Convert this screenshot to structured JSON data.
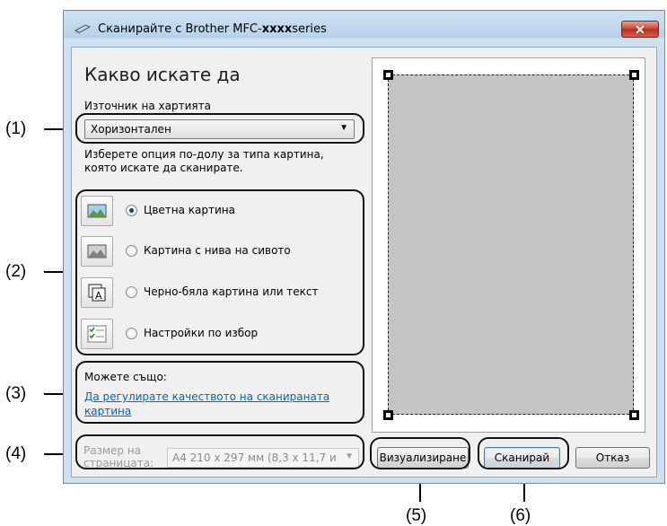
{
  "window": {
    "title_prefix": "Сканирайте с Brother MFC-",
    "title_bold": "xxxx",
    "title_suffix": "series",
    "close_label": "✕"
  },
  "heading": "Какво искате да",
  "paper_source": {
    "label": "Източник на хартията",
    "value": "Хоризонтален"
  },
  "instruction": {
    "line1": "Изберете опция по-долу за типа картина,",
    "line2": "която искате да сканирате."
  },
  "options": [
    {
      "label": "Цветна картина",
      "selected": true,
      "icon": "color-picture-icon"
    },
    {
      "label": "Картина с нива на сивото",
      "selected": false,
      "icon": "grayscale-picture-icon"
    },
    {
      "label": "Черно-бяла картина или текст",
      "selected": false,
      "icon": "bw-text-icon"
    },
    {
      "label": "Настройки по избор",
      "selected": false,
      "icon": "custom-settings-icon"
    }
  ],
  "also": {
    "label": "Можете също:",
    "link_line1": "Да регулирате качеството на сканираната",
    "link_line2": "картина"
  },
  "page_size": {
    "label_line1": "Размер на",
    "label_line2": "страницата:",
    "value": "A4 210 x 297 мм (8,3 x 11,7 и"
  },
  "buttons": {
    "preview": "Визуализиране",
    "scan": "Сканирай",
    "cancel": "Отказ"
  },
  "callouts": [
    "(1)",
    "(2)",
    "(3)",
    "(4)",
    "(5)",
    "(6)"
  ]
}
